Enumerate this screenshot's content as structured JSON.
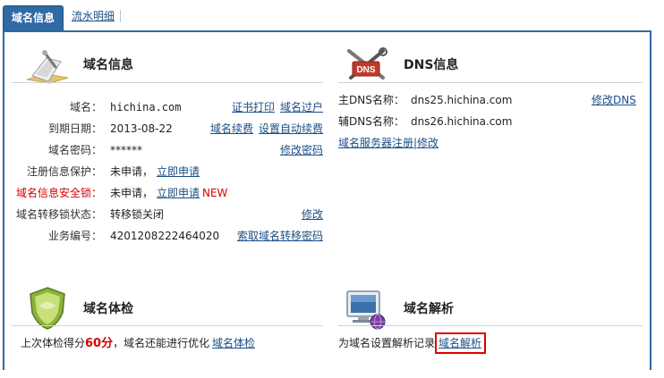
{
  "tabs": {
    "active_label": "域名信息",
    "second_label": "流水明细"
  },
  "domain_info": {
    "title": "域名信息",
    "rows": {
      "domain_label": "域名：",
      "domain_value": "hichina.com",
      "cert_print": "证书打印",
      "transfer_out": "域名过户",
      "expiry_label": "到期日期：",
      "expiry_value": "2013-08-22",
      "renew": "域名续费",
      "auto_renew": "设置自动续费",
      "password_label": "域名密码：",
      "password_value": "******",
      "change_password": "修改密码",
      "privacy_label": "注册信息保护：",
      "privacy_value": "未申请，",
      "privacy_apply": "立即申请",
      "lock_label": "域名信息安全锁：",
      "lock_value": "未申请，",
      "lock_apply": "立即申请",
      "lock_new": "NEW",
      "transfer_lock_label": "域名转移锁状态：",
      "transfer_lock_value": "转移锁关闭",
      "transfer_lock_change": "修改",
      "order_label": "业务编号：",
      "order_value": "4201208222464020",
      "get_transfer_code": "索取域名转移密码"
    }
  },
  "dns_info": {
    "title": "DNS信息",
    "primary_label": "主DNS名称：",
    "primary_value": "dns25.hichina.com",
    "modify_dns": "修改DNS",
    "secondary_label": "辅DNS名称：",
    "secondary_value": "dns26.hichina.com",
    "register_ns": "域名服务器注册|修改",
    "icon_text": "DNS"
  },
  "health_check": {
    "title": "域名体检",
    "text_before": "上次体检得分",
    "score": "60分",
    "text_after": "，域名还能进行优化",
    "link": "域名体检"
  },
  "resolution": {
    "title": "域名解析",
    "text": "为域名设置解析记录",
    "link": "域名解析"
  },
  "colors": {
    "tab_blue": "#2f6aa3",
    "link_blue": "#1a4f86",
    "alert_red": "#d40000",
    "highlight_red": "#e00000"
  }
}
